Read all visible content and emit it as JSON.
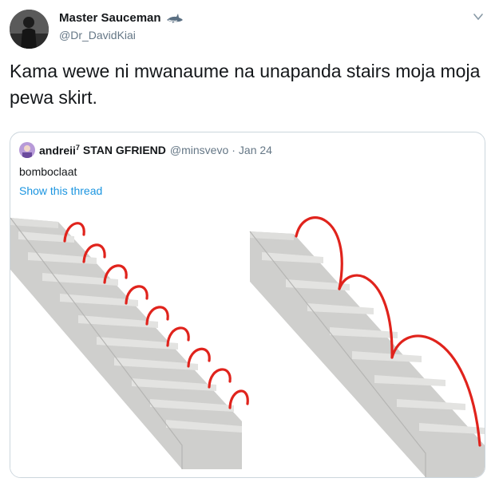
{
  "tweet": {
    "display_name": "Master Sauceman",
    "handle": "@Dr_DavidKiai",
    "text": "Kama wewe ni mwanaume na unapanda stairs moja moja pewa skirt."
  },
  "quoted": {
    "display_name": "andreii",
    "superscript": "7",
    "name_suffix": "STAN GFRIEND",
    "handle": "@minsvevo",
    "separator": "·",
    "date": "Jan 24",
    "text": "bomboclaat",
    "show_thread": "Show this thread"
  },
  "icons": {
    "name_emoji": "shark-icon",
    "menu": "chevron-down-icon"
  },
  "colors": {
    "link": "#1b95e0",
    "muted": "#657786",
    "border": "#ccd6dd",
    "arc": "#e0231c"
  }
}
